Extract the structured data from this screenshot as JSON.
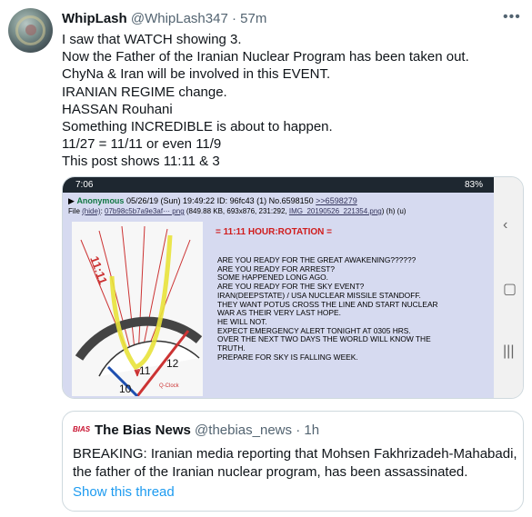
{
  "tweet": {
    "author_name": "WhipLash",
    "author_handle": "@WhipLash347",
    "separator": "·",
    "time": "57m",
    "more_icon": "more-horizontal-icon",
    "lines": [
      "I saw that WATCH showing 3.",
      "Now the Father of the Iranian Nuclear Program has been taken out.",
      "ChyNa & Iran will be involved in this EVENT.",
      "IRANIAN REGIME change.",
      "HASSAN Rouhani",
      "Something INCREDIBLE is about to happen.",
      "11/27 = 11/11 or even 11/9",
      "This post shows 11:11 & 3"
    ]
  },
  "media": {
    "status_time": "7:06",
    "status_battery": "83%",
    "post_name": "Anonymous",
    "post_date": "05/26/19 (Sun) 19:49:22",
    "post_id": "ID: 96fc43 (1)",
    "post_no": "No.6598150",
    "post_reply": ">>6598279",
    "file_label": "File",
    "file_hide": "(hide)",
    "file_name": "07b98c5b7a9e3af··· png",
    "file_meta": "(849.88 KB, 693x876, 231:292,",
    "file_img": "IMG_20190526_221354.png",
    "file_tail": ") (h) (u)",
    "clock_labels": [
      "11:11",
      "11",
      "12",
      "10",
      "Q-Clock"
    ],
    "heading": "= 11:11 HOUR:ROTATION =",
    "body_lines": [
      "ARE YOU READY FOR THE GREAT AWAKENING??????",
      "ARE YOU READY FOR ARREST?",
      "SOME HAPPENED LONG AGO.",
      "ARE YOU READY FOR THE SKY EVENT?",
      "IRAN(DEEPSTATE) / USA NUCLEAR MISSILE STANDOFF.",
      "THEY WANT POTUS CROSS THE LINE AND START NUCLEAR",
      "WAR AS THEIR VERY LAST HOPE.",
      "HE WILL NOT.",
      "EXPECT EMERGENCY ALERT TONIGHT AT 0305 HRS.",
      "OVER THE NEXT TWO DAYS THE WORLD WILL KNOW THE",
      "TRUTH.",
      "PREPARE FOR SKY IS FALLING WEEK."
    ]
  },
  "quote": {
    "logo_text": "BIAS",
    "author_name": "The Bias News",
    "author_handle": "@thebias_news",
    "separator": "·",
    "time": "1h",
    "text": "BREAKING: Iranian media reporting that Mohsen Fakhrizadeh-Mahabadi, the father of the Iranian nuclear program, has been assassinated.",
    "show_thread": "Show this thread"
  }
}
